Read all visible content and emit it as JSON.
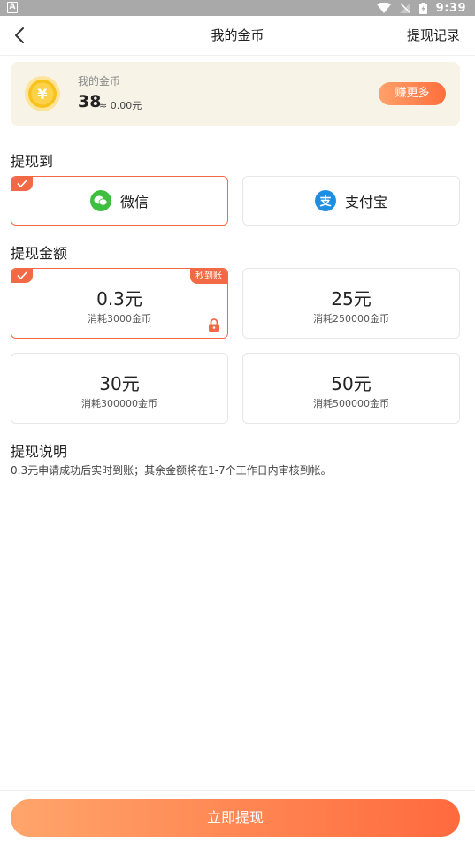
{
  "statusbar": {
    "time": "9:39"
  },
  "header": {
    "title": "我的金币",
    "record_label": "提现记录"
  },
  "coins": {
    "label": "我的金币",
    "amount": "38",
    "approx": "≈ 0.00元",
    "earn_label": "赚更多"
  },
  "withdraw_to": {
    "title": "提现到",
    "methods": [
      {
        "label": "微信",
        "selected": true
      },
      {
        "label": "支付宝",
        "selected": false
      }
    ]
  },
  "amounts": {
    "title": "提现金额",
    "options": [
      {
        "amount": "0.3元",
        "cost": "消耗3000金币",
        "badge": "秒到账",
        "selected": true
      },
      {
        "amount": "25元",
        "cost": "消耗250000金币"
      },
      {
        "amount": "30元",
        "cost": "消耗300000金币"
      },
      {
        "amount": "50元",
        "cost": "消耗500000金币"
      }
    ]
  },
  "notes": {
    "title": "提现说明",
    "text": "0.3元申请成功后实时到账；其余金额将在1-7个工作日内审核到帐。"
  },
  "submit_label": "立即提现",
  "colors": {
    "accent": "#f26a45",
    "wechat": "#3fbf3f",
    "alipay": "#1e8fe0",
    "coin": "#f8c21d"
  }
}
